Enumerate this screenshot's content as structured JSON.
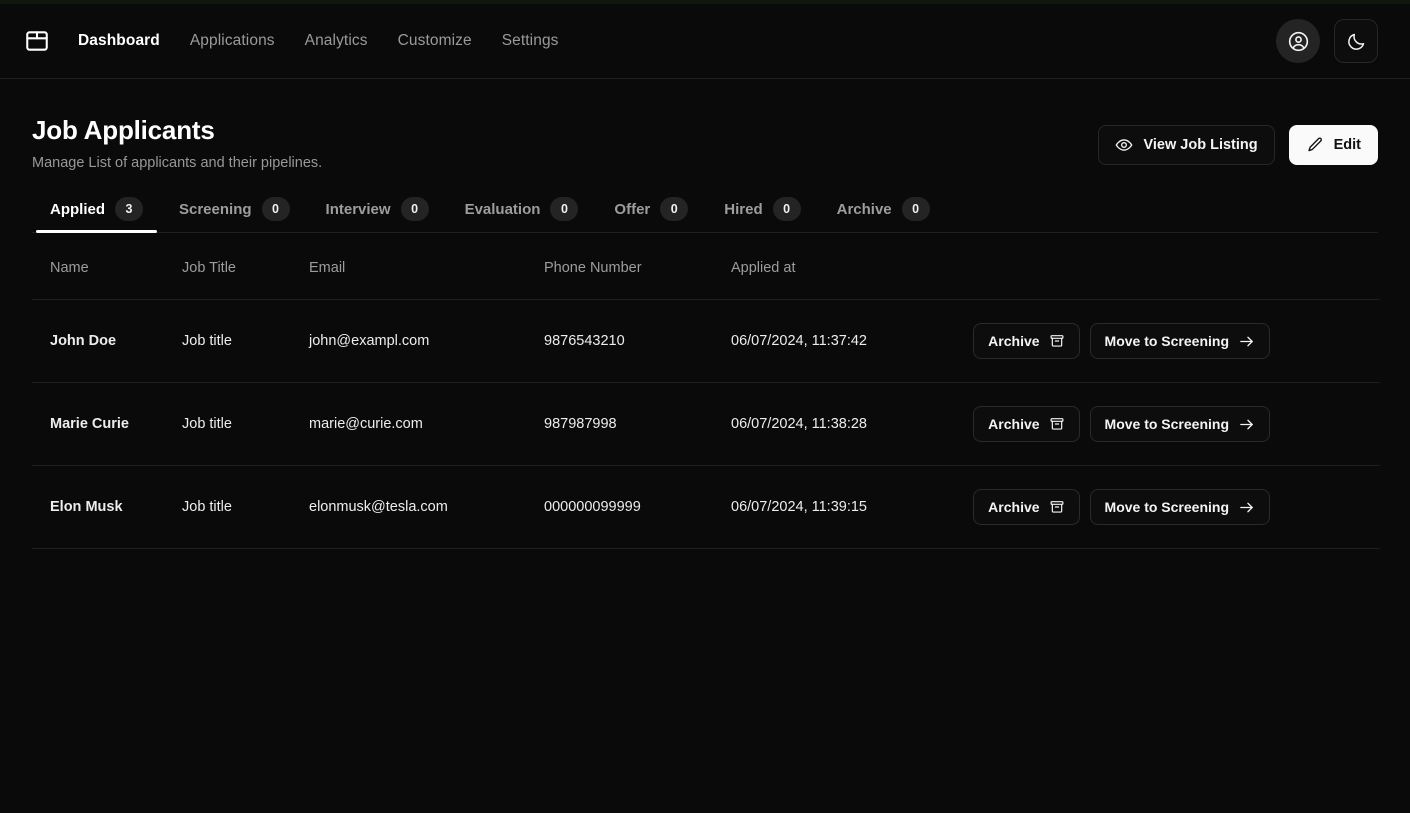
{
  "navbar": {
    "logo_icon": "package-icon",
    "links": [
      {
        "label": "Dashboard",
        "active": true
      },
      {
        "label": "Applications",
        "active": false
      },
      {
        "label": "Analytics",
        "active": false
      },
      {
        "label": "Customize",
        "active": false
      },
      {
        "label": "Settings",
        "active": false
      }
    ],
    "avatar_icon": "user-circle-icon",
    "theme_icon": "moon-icon"
  },
  "header": {
    "title": "Job Applicants",
    "subtitle": "Manage List of applicants and their pipelines.",
    "view_listing_label": "View Job Listing",
    "view_listing_icon": "eye-icon",
    "edit_label": "Edit",
    "edit_icon": "pencil-icon"
  },
  "tabs": [
    {
      "label": "Applied",
      "count": "3",
      "active": true
    },
    {
      "label": "Screening",
      "count": "0",
      "active": false
    },
    {
      "label": "Interview",
      "count": "0",
      "active": false
    },
    {
      "label": "Evaluation",
      "count": "0",
      "active": false
    },
    {
      "label": "Offer",
      "count": "0",
      "active": false
    },
    {
      "label": "Hired",
      "count": "0",
      "active": false
    },
    {
      "label": "Archive",
      "count": "0",
      "active": false
    }
  ],
  "table": {
    "columns": [
      "Name",
      "Job Title",
      "Email",
      "Phone Number",
      "Applied at"
    ],
    "row_actions": {
      "archive_label": "Archive",
      "archive_icon": "archive-box-icon",
      "move_label": "Move to Screening",
      "move_icon": "arrow-right-icon"
    },
    "rows": [
      {
        "name": "John Doe",
        "job_title": "Job title",
        "email": "john@exampl.com",
        "phone": "9876543210",
        "applied_at": "06/07/2024, 11:37:42"
      },
      {
        "name": "Marie Curie",
        "job_title": "Job title",
        "email": "marie@curie.com",
        "phone": "987987998",
        "applied_at": "06/07/2024, 11:38:28"
      },
      {
        "name": "Elon Musk",
        "job_title": "Job title",
        "email": "elonmusk@tesla.com",
        "phone": "000000099999",
        "applied_at": "06/07/2024, 11:39:15"
      }
    ]
  },
  "colors": {
    "background": "#0a0a0a",
    "surface": "#0d0d0d",
    "border": "#1f1f1f",
    "badge": "#242424",
    "text_primary": "#ffffff",
    "text_muted": "#9a9a9a",
    "accent_light": "#fafafa"
  }
}
